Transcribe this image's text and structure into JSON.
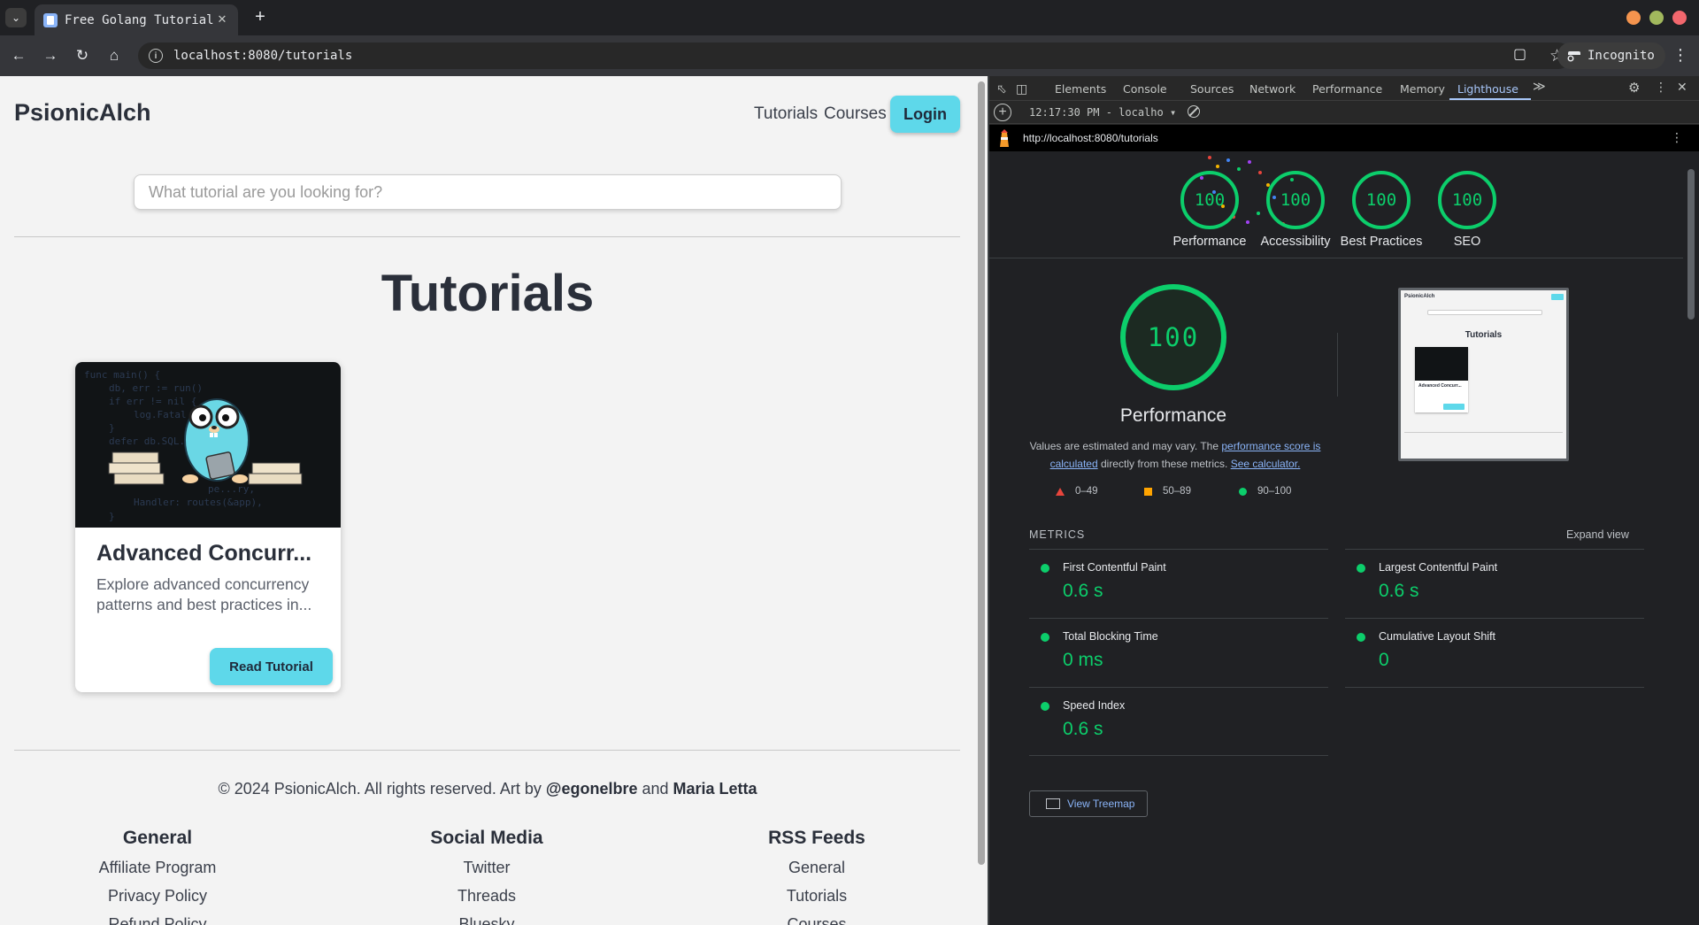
{
  "browser": {
    "tab_title": "Free Golang Tutorials",
    "tab_close": "✕",
    "new_tab": "+",
    "url": "localhost:8080/tutorials",
    "profile": "Incognito",
    "window_colors": [
      "#f4944e",
      "#a1b85d",
      "#f2676d"
    ]
  },
  "site": {
    "brand": "PsionicAlch",
    "nav": {
      "tutorials": "Tutorials",
      "courses": "Courses",
      "login": "Login"
    },
    "search_placeholder": "What tutorial are you looking for?",
    "page_title": "Tutorials",
    "card": {
      "title": "Advanced Concurr...",
      "description": "Explore advanced concurrency patterns and best practices in...",
      "button": "Read Tutorial",
      "code_lines": [
        "func main() {",
        "db, err := run()",
        "if err != nil {",
        "log.Fatal",
        "}",
        "defer db.SQL...",
        "",
        "",
        "pe...ry,",
        "Handler: routes(&app),",
        "}"
      ]
    },
    "footer": {
      "copyright_prefix": "© 2024 PsionicAlch. All rights reserved. Art by ",
      "artist_1": "@egonelbre",
      "and": " and ",
      "artist_2": "Maria Letta",
      "general": {
        "heading": "General",
        "items": [
          "Affiliate Program",
          "Privacy Policy",
          "Refund Policy"
        ]
      },
      "social": {
        "heading": "Social Media",
        "items": [
          "Twitter",
          "Threads",
          "Bluesky"
        ]
      },
      "rss": {
        "heading": "RSS Feeds",
        "items": [
          "General",
          "Tutorials",
          "Courses"
        ]
      }
    },
    "accent_color": "#5ed8ea"
  },
  "devtools": {
    "tabs": [
      "Elements",
      "Console",
      "Sources",
      "Network",
      "Performance",
      "Memory",
      "Lighthouse"
    ],
    "active_tab": "Lighthouse",
    "more_tabs": "≫",
    "report_time": "12:17:30 PM - localho",
    "report_url": "http://localhost:8080/tutorials",
    "scores": [
      {
        "label": "Performance",
        "score": "100"
      },
      {
        "label": "Accessibility",
        "score": "100"
      },
      {
        "label": "Best Practices",
        "score": "100"
      },
      {
        "label": "SEO",
        "score": "100"
      }
    ],
    "performance": {
      "score": "100",
      "title": "Performance",
      "note_prefix": "Values are estimated and may vary. The ",
      "note_link_1": "performance score is calculated",
      "note_middle": " directly from these metrics. ",
      "note_link_2": "See calculator.",
      "legend": [
        "0–49",
        "50–89",
        "90–100"
      ]
    },
    "thumbnail": {
      "brand": "PsionicAlch",
      "title": "Tutorials",
      "card_title": "Advanced Concurr..."
    },
    "metrics_header": "METRICS",
    "expand_view": "Expand view",
    "metrics": [
      {
        "name": "First Contentful Paint",
        "value": "0.6 s"
      },
      {
        "name": "Largest Contentful Paint",
        "value": "0.6 s"
      },
      {
        "name": "Total Blocking Time",
        "value": "0 ms"
      },
      {
        "name": "Cumulative Layout Shift",
        "value": "0"
      },
      {
        "name": "Speed Index",
        "value": "0.6 s"
      }
    ],
    "treemap_button": "View Treemap",
    "pass_color": "#0cce6b"
  }
}
